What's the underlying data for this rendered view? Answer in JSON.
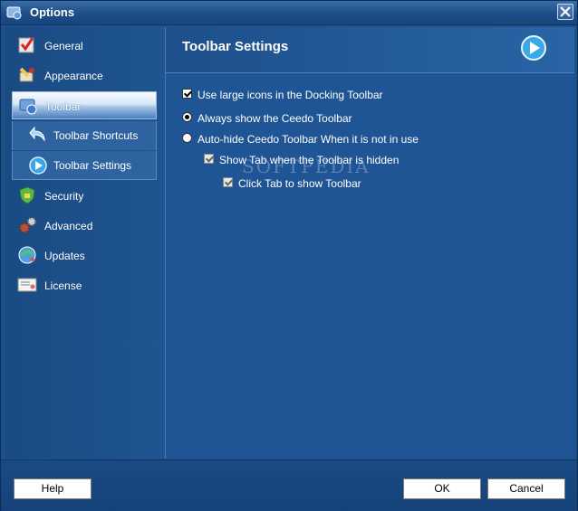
{
  "window": {
    "title": "Options"
  },
  "sidebar": {
    "items": [
      {
        "label": "General",
        "icon": "general-icon"
      },
      {
        "label": "Appearance",
        "icon": "appearance-icon"
      },
      {
        "label": "Toolbar",
        "icon": "toolbar-icon",
        "selected": true
      },
      {
        "label": "Security",
        "icon": "security-icon"
      },
      {
        "label": "Advanced",
        "icon": "advanced-icon"
      },
      {
        "label": "Updates",
        "icon": "updates-icon"
      },
      {
        "label": "License",
        "icon": "license-icon"
      }
    ],
    "subitems": [
      {
        "label": "Toolbar Shortcuts",
        "icon": "toolbar-shortcuts-icon"
      },
      {
        "label": "Toolbar Settings",
        "icon": "toolbar-settings-icon"
      }
    ]
  },
  "content": {
    "title": "Toolbar Settings",
    "options": {
      "large_icons": {
        "label": "Use large icons in the Docking Toolbar",
        "checked": true
      },
      "always_show": {
        "label": "Always show the Ceedo Toolbar",
        "selected": true
      },
      "auto_hide": {
        "label": "Auto-hide Ceedo Toolbar When it is not in use",
        "selected": false
      },
      "show_tab": {
        "label": "Show Tab when the Toolbar is hidden",
        "checked": true,
        "enabled": false
      },
      "click_tab": {
        "label": "Click Tab to show Toolbar",
        "checked": true,
        "enabled": false
      }
    },
    "watermark": "SOFTPEDIA"
  },
  "footer": {
    "help_label": "Help",
    "ok_label": "OK",
    "cancel_label": "Cancel"
  },
  "colors": {
    "background": "#1e5089",
    "header": "#2a64a5",
    "selected_item": "#d7e6f6"
  }
}
